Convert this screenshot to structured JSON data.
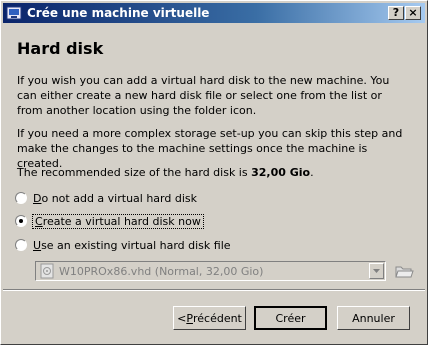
{
  "window": {
    "title": "Crée une machine virtuelle",
    "help_label": "?",
    "close_label": "×"
  },
  "page": {
    "title": "Hard disk",
    "paragraph1": "If you wish you can add a virtual hard disk to the new machine. You can either create a new hard disk file or select one from the list or from another location using the folder icon.",
    "paragraph2": "If you need a more complex storage set-up you can skip this step and make the changes to the machine settings once the machine is created.",
    "recommended_prefix": "The recommended size of the hard disk is ",
    "recommended_size": "32,00 Gio",
    "recommended_suffix": "."
  },
  "options": {
    "no_disk": {
      "mnemonic": "D",
      "rest": "o not add a virtual hard disk",
      "selected": false
    },
    "create_disk": {
      "mnemonic": "C",
      "rest": "reate a virtual hard disk now",
      "selected": true
    },
    "use_existing": {
      "mnemonic": "U",
      "rest": "se an existing virtual hard disk file",
      "selected": false
    }
  },
  "existing_disk": {
    "value": "W10PROx86.vhd (Normal, 32,00 Gio)",
    "icons": {
      "file": "disk-file-icon",
      "folder": "folder-icon",
      "dropdown": "chevron-down-icon"
    }
  },
  "buttons": {
    "prev_prefix": "< ",
    "prev_mnemonic": "P",
    "prev_rest": "récédent",
    "create": "Créer",
    "cancel": "Annuler"
  },
  "colors": {
    "titlebar_start": "#0a246a",
    "titlebar_end": "#a6caf0",
    "dialog_bg": "#d4d0c8"
  }
}
